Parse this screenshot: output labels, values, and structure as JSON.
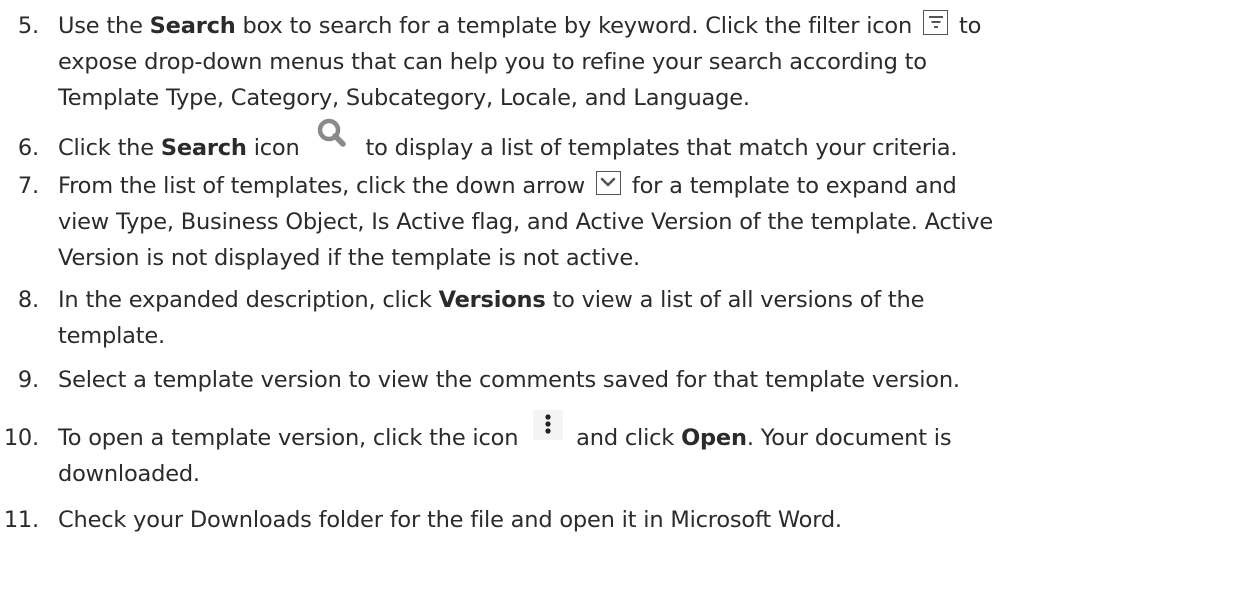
{
  "steps": [
    {
      "number": "5.",
      "lines": [
        {
          "t1": "Use the ",
          "b1": "Search",
          "t2": " box to search for a template by keyword. Click the filter icon ",
          "t3": " to"
        },
        {
          "t1": "expose drop-down menus that can help you to refine your search according to"
        },
        {
          "t1": "Template Type, Category, Subcategory, Locale, and Language."
        }
      ]
    },
    {
      "number": "6.",
      "lines": [
        {
          "t1": "Click the ",
          "b1": "Search",
          "t2": " icon ",
          "t3": " to display a list of templates that match your criteria."
        }
      ]
    },
    {
      "number": "7.",
      "lines": [
        {
          "t1": "From the list of templates, click the down arrow ",
          "t2": " for a template to expand and"
        },
        {
          "t1": "view Type, Business Object, Is Active flag, and Active Version of the template. Active"
        },
        {
          "t1": "Version is not displayed if the template is not active."
        }
      ]
    },
    {
      "number": "8.",
      "lines": [
        {
          "t1": "In the expanded description, click ",
          "b1": "Versions",
          "t2": " to view a list of all versions of the"
        },
        {
          "t1": "template."
        }
      ]
    },
    {
      "number": "9.",
      "lines": [
        {
          "t1": "Select a template version to view the comments saved for that template version."
        }
      ]
    },
    {
      "number": "10.",
      "lines": [
        {
          "t1": "To open a template version, click the icon ",
          "t2": " and click ",
          "b1": "Open",
          "t3": ". Your document is"
        },
        {
          "t1": "downloaded."
        }
      ]
    },
    {
      "number": "11.",
      "lines": [
        {
          "t1": "Check your Downloads folder for the file and open it in Microsoft Word."
        }
      ]
    }
  ],
  "icons": {
    "filter": "filter-icon",
    "search": "search-icon",
    "expand": "chevron-down-icon",
    "more": "more-vertical-icon"
  },
  "colors": {
    "text": "#2b2b2b",
    "icon_gray": "#8a8a8a",
    "icon_border": "#555555"
  }
}
